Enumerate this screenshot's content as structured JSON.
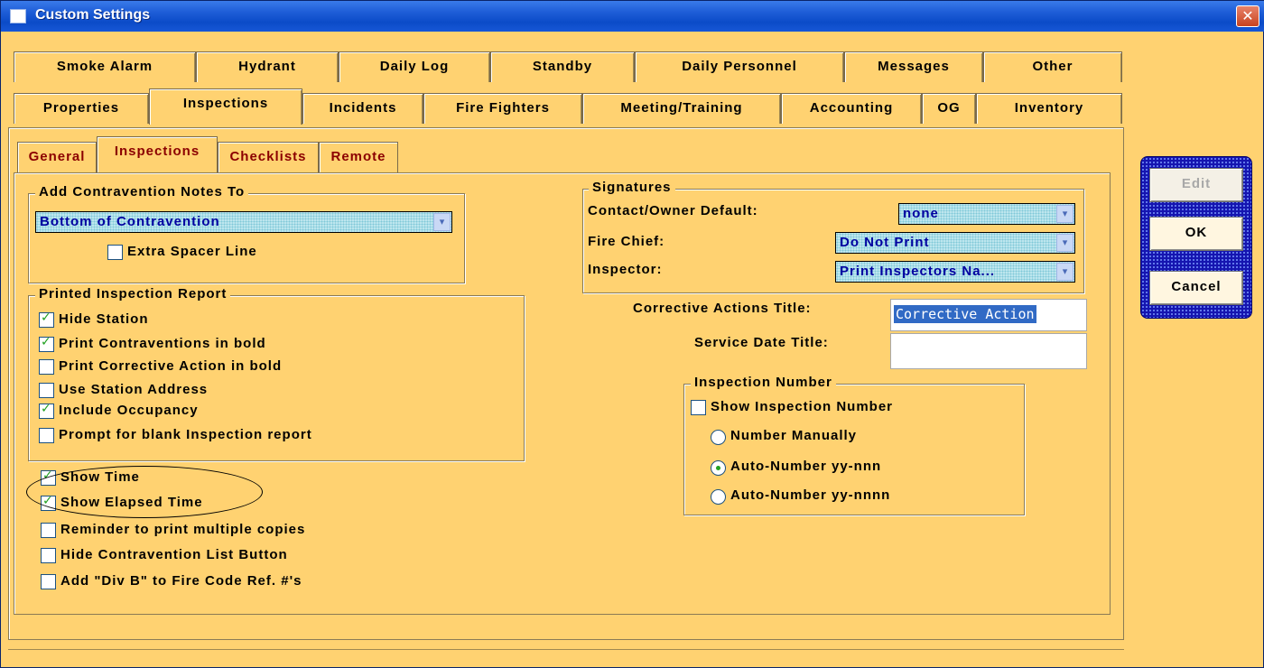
{
  "window": {
    "title": "Custom Settings",
    "close_glyph": "✕"
  },
  "tabs_row1": [
    "Smoke Alarm",
    "Hydrant",
    "Daily Log",
    "Standby",
    "Daily Personnel",
    "Messages",
    "Other"
  ],
  "tabs_row2": [
    "Properties",
    "Inspections",
    "Incidents",
    "Fire Fighters",
    "Meeting/Training",
    "Accounting",
    "OG",
    "Inventory"
  ],
  "active_tab": "Inspections",
  "subtabs": [
    "General",
    "Inspections",
    "Checklists",
    "Remote"
  ],
  "active_subtab": "Inspections",
  "contravention_notes": {
    "title": "Add Contravention Notes To",
    "selected": "Bottom of Contravention",
    "extra_spacer_label": "Extra Spacer Line",
    "extra_spacer_checked": false
  },
  "printed_report": {
    "title": "Printed Inspection Report",
    "options": [
      {
        "label": "Hide Station",
        "checked": true
      },
      {
        "label": "Print Contraventions in bold",
        "checked": true
      },
      {
        "label": "Print Corrective Action in bold",
        "checked": false
      },
      {
        "label": "Use Station Address",
        "checked": false
      },
      {
        "label": "Include Occupancy",
        "checked": true
      },
      {
        "label": "Prompt for blank Inspection report",
        "checked": false
      }
    ]
  },
  "extra_options": [
    {
      "label": "Show Time",
      "checked": true
    },
    {
      "label": "Show Elapsed Time",
      "checked": true
    },
    {
      "label": "Reminder to print multiple copies",
      "checked": false
    },
    {
      "label": "Hide Contravention List Button",
      "checked": false
    },
    {
      "label": "Add \"Div B\" to Fire Code Ref. #'s",
      "checked": false
    }
  ],
  "signatures": {
    "title": "Signatures",
    "rows": [
      {
        "label": "Contact/Owner Default:",
        "value": "none"
      },
      {
        "label": "Fire Chief:",
        "value": "Do Not Print"
      },
      {
        "label": "Inspector:",
        "value": "Print Inspectors Na..."
      }
    ]
  },
  "corrective_actions": {
    "label": "Corrective Actions Title:",
    "value": "Corrective Action"
  },
  "service_date": {
    "label": "Service Date Title:",
    "value": ""
  },
  "inspection_number": {
    "title": "Inspection Number",
    "show_label": "Show Inspection Number",
    "show_checked": false,
    "radios": [
      {
        "label": "Number Manually",
        "selected": false
      },
      {
        "label": "Auto-Number yy-nnn",
        "selected": true
      },
      {
        "label": "Auto-Number yy-nnnn",
        "selected": false
      }
    ]
  },
  "buttons": {
    "edit": "Edit",
    "ok": "OK",
    "cancel": "Cancel"
  },
  "icons": {
    "dropdown": "▾",
    "check": "✓"
  },
  "colors": {
    "background": "#FFD271",
    "titlebar": "#0B4BC8",
    "combo_text": "#0000A0",
    "subtab_text": "#8B0000",
    "button_panel": "#1515B0"
  }
}
